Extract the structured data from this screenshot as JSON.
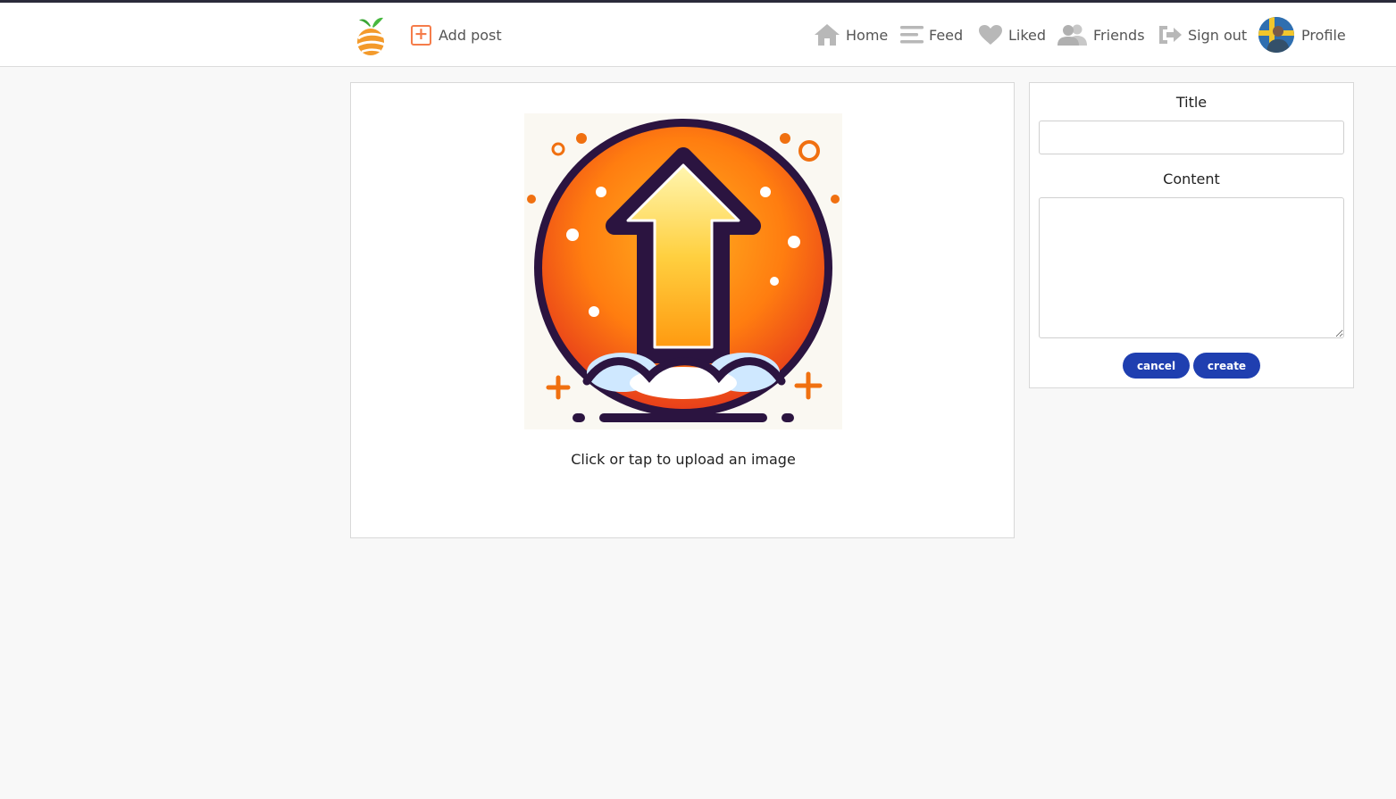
{
  "nav": {
    "add_post": "Add post",
    "items": [
      {
        "label": "Home",
        "icon": "home-icon"
      },
      {
        "label": "Feed",
        "icon": "feed-icon"
      },
      {
        "label": "Liked",
        "icon": "heart-icon"
      },
      {
        "label": "Friends",
        "icon": "friends-icon"
      },
      {
        "label": "Sign out",
        "icon": "sign-out-icon"
      },
      {
        "label": "Profile",
        "icon": "avatar"
      }
    ]
  },
  "upload": {
    "hint": "Click or tap to upload an image"
  },
  "form": {
    "title_label": "Title",
    "title_value": "",
    "content_label": "Content",
    "content_value": "",
    "cancel_label": "cancel",
    "create_label": "create"
  },
  "colors": {
    "accent": "#f57c4a",
    "button": "#1f3fb0",
    "nav_icon": "#b8b8b8"
  }
}
